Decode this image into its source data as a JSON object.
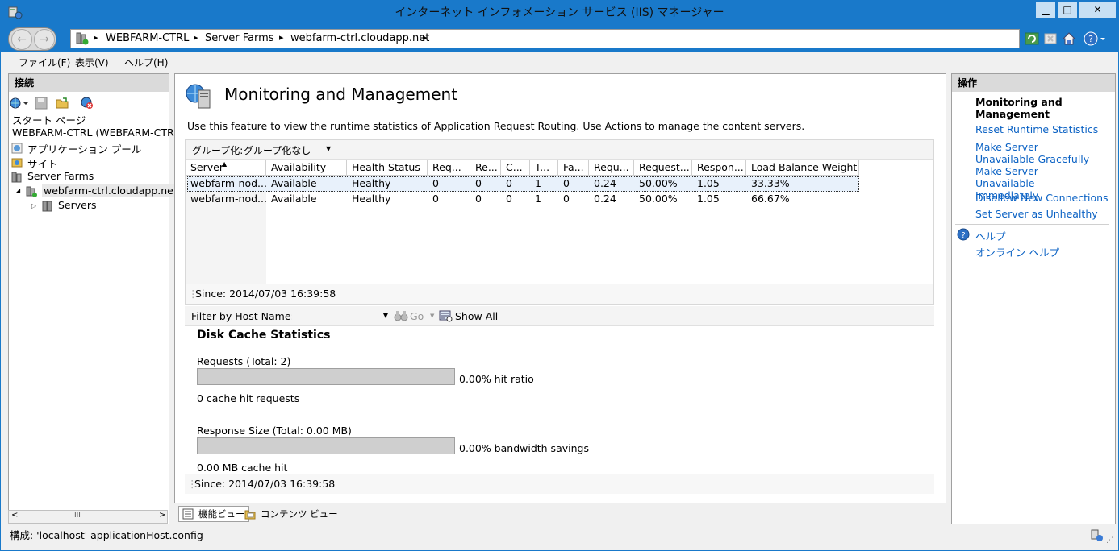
{
  "window": {
    "title": "インターネット インフォメーション サービス (IIS) マネージャー",
    "min_label": "▁",
    "max_label": "□",
    "close_label": "✕"
  },
  "nav": {
    "breadcrumb": [
      "WEBFARM-CTRL",
      "Server Farms",
      "webfarm-ctrl.cloudapp.net"
    ],
    "sep": "▸"
  },
  "menu": {
    "items": [
      "ファイル(F)",
      "表示(V)",
      "ヘルプ(H)"
    ]
  },
  "connections": {
    "header": "接続",
    "tree": [
      {
        "label": "スタート ページ"
      },
      {
        "label": "WEBFARM-CTRL (WEBFARM-CTR"
      },
      {
        "label": "アプリケーション プール"
      },
      {
        "label": "サイト"
      },
      {
        "label": "Server Farms"
      },
      {
        "label": "webfarm-ctrl.cloudapp.net"
      },
      {
        "label": "Servers"
      }
    ],
    "scroll_mid": "III"
  },
  "main": {
    "title": "Monitoring and Management",
    "description": "Use this feature to view the runtime statistics of Application Request Routing. Use Actions to manage the content servers.",
    "group_label": "グループ化:",
    "group_value": "グループ化なし",
    "columns": [
      "Server",
      "Availability",
      "Health Status",
      "Req...",
      "Re...",
      "C...",
      "T...",
      "Fa...",
      "Requ...",
      "Request...",
      "Respon...",
      "Load Balance Weight"
    ],
    "rows": [
      [
        "webfarm-nod...",
        "Available",
        "Healthy",
        "0",
        "0",
        "0",
        "1",
        "0",
        "0.24",
        "50.00%",
        "1.05",
        "33.33%"
      ],
      [
        "webfarm-nod...",
        "Available",
        "Healthy",
        "0",
        "0",
        "0",
        "1",
        "0",
        "0.24",
        "50.00%",
        "1.05",
        "66.67%"
      ]
    ],
    "since_1": "Since: 2014/07/03 16:39:58",
    "filter_label": "Filter by Host Name:",
    "go_label": "Go",
    "show_all_label": "Show All",
    "disk_cache": {
      "title": "Disk Cache Statistics",
      "requests_label": "Requests (Total: 2)",
      "hit_ratio": "0.00% hit ratio",
      "hit_ratio_value": 0,
      "cache_hit_requests": "0 cache hit requests",
      "response_size_label": "Response Size (Total: 0.00 MB)",
      "bandwidth_savings": "0.00% bandwidth savings",
      "bandwidth_value": 0,
      "cache_hit_mb": "0.00 MB cache hit"
    },
    "since_2": "Since: 2014/07/03 16:39:58"
  },
  "bottom_tabs": [
    "機能ビュー",
    "コンテンツ ビュー"
  ],
  "actions": {
    "header": "操作",
    "title": "Monitoring and Management",
    "items": [
      "Reset Runtime Statistics",
      "Make Server Unavailable Gracefully",
      "Make Server Unavailable Immediately",
      "Disallow New Connections",
      "Set Server as Unhealthy"
    ],
    "help": "ヘルプ",
    "online_help": "オンライン ヘルプ"
  },
  "status_bar": {
    "text": "構成: 'localhost' applicationHost.config"
  },
  "colors": {
    "chrome": "#1979ca",
    "link": "#0b62c4"
  }
}
